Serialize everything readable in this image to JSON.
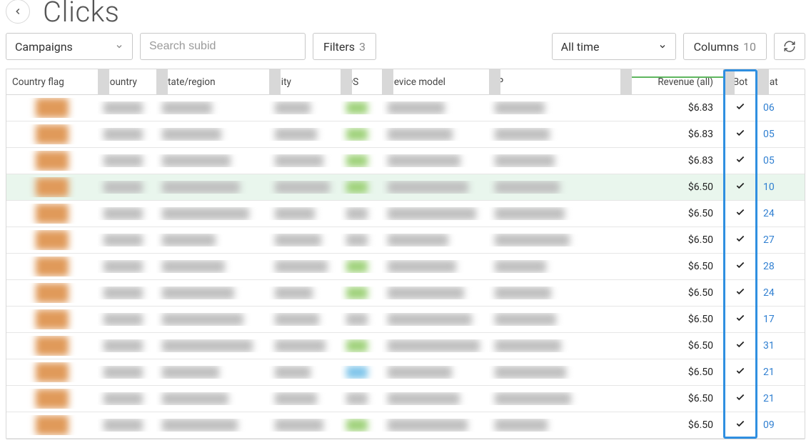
{
  "header": {
    "title": "Clicks"
  },
  "toolbar": {
    "campaigns_label": "Campaigns",
    "search_placeholder": "Search subid",
    "filters_label": "Filters",
    "filters_count": "3",
    "alltime_label": "All time",
    "columns_label": "Columns",
    "columns_count": "10"
  },
  "columns": {
    "country_flag": "Country flag",
    "country": "Country",
    "state_region": "State/region",
    "city": "City",
    "os": "OS",
    "device_model": "Device model",
    "ip": "IP",
    "revenue_all": "Revenue (all)",
    "bot": "Bot",
    "date": "Dat"
  },
  "rows": [
    {
      "revenue": "$6.83",
      "bot": "✓",
      "date": "06",
      "os_tone": "green",
      "hl": false
    },
    {
      "revenue": "$6.83",
      "bot": "✓",
      "date": "05",
      "os_tone": "green",
      "hl": false
    },
    {
      "revenue": "$6.83",
      "bot": "✓",
      "date": "05",
      "os_tone": "green",
      "hl": false
    },
    {
      "revenue": "$6.50",
      "bot": "✓",
      "date": "10",
      "os_tone": "green",
      "hl": true
    },
    {
      "revenue": "$6.50",
      "bot": "✓",
      "date": "24",
      "os_tone": "gray",
      "hl": false
    },
    {
      "revenue": "$6.50",
      "bot": "✓",
      "date": "27",
      "os_tone": "gray",
      "hl": false
    },
    {
      "revenue": "$6.50",
      "bot": "✓",
      "date": "28",
      "os_tone": "green",
      "hl": false
    },
    {
      "revenue": "$6.50",
      "bot": "✓",
      "date": "24",
      "os_tone": "green",
      "hl": false
    },
    {
      "revenue": "$6.50",
      "bot": "✓",
      "date": "17",
      "os_tone": "gray",
      "hl": false
    },
    {
      "revenue": "$6.50",
      "bot": "✓",
      "date": "31",
      "os_tone": "green",
      "hl": false
    },
    {
      "revenue": "$6.50",
      "bot": "✓",
      "date": "21",
      "os_tone": "blue",
      "hl": false
    },
    {
      "revenue": "$6.50",
      "bot": "✓",
      "date": "21",
      "os_tone": "gray",
      "hl": false
    },
    {
      "revenue": "$6.50",
      "bot": "✓",
      "date": "09",
      "os_tone": "green",
      "hl": false
    }
  ]
}
